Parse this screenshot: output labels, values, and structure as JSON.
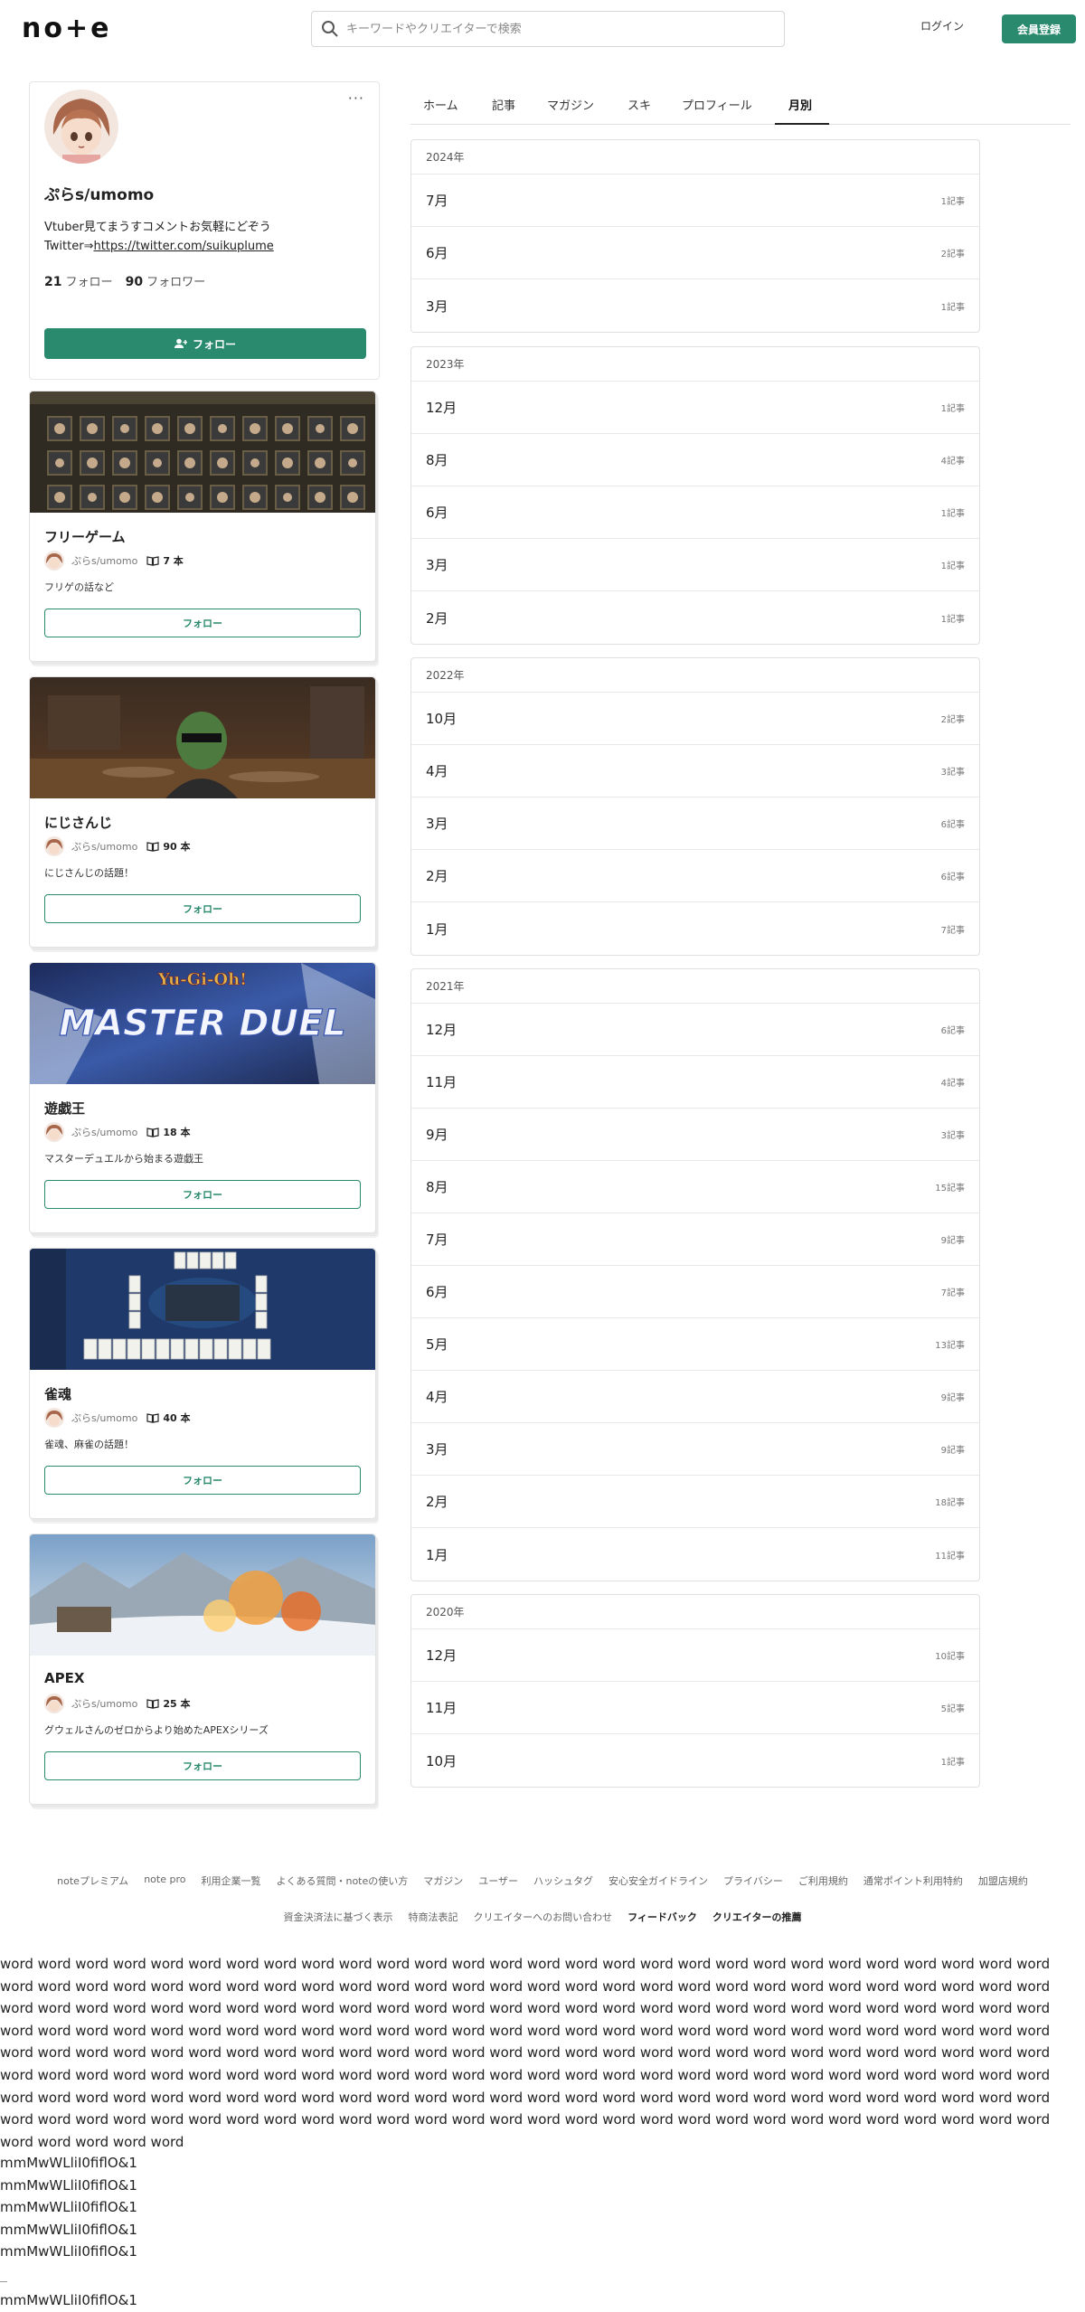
{
  "header": {
    "logo": "no+e",
    "search_placeholder": "キーワードやクリエイターで検索",
    "login": "ログイン",
    "signup": "会員登録"
  },
  "profile": {
    "name": "ぷらs/umomo",
    "bio_line1": "Vtuber見てまうすコメントお気軽にどぞう",
    "bio_line2_prefix": "Twitter⇒",
    "bio_link": "https://twitter.com/suikuplume",
    "following_count": "21",
    "following_label": "フォロー",
    "followers_count": "90",
    "followers_label": "フォロワー",
    "follow_button": "フォロー",
    "more": "···"
  },
  "magazines": [
    {
      "title": "フリーゲーム",
      "author": "ぷらs/umomo",
      "count": "7 本",
      "desc": "フリゲの話など",
      "follow": "フォロー"
    },
    {
      "title": "にじさんじ",
      "author": "ぷらs/umomo",
      "count": "90 本",
      "desc": "にじさんじの話題！",
      "follow": "フォロー"
    },
    {
      "title": "遊戯王",
      "author": "ぷらs/umomo",
      "count": "18 本",
      "desc": "マスターデュエルから始まる遊戯王",
      "follow": "フォロー",
      "thumb_text_top": "Yu-Gi-Oh!",
      "thumb_text_main": "MASTER DUEL"
    },
    {
      "title": "雀魂",
      "author": "ぷらs/umomo",
      "count": "40 本",
      "desc": "雀魂、麻雀の話題！",
      "follow": "フォロー"
    },
    {
      "title": "APEX",
      "author": "ぷらs/umomo",
      "count": "25 本",
      "desc": "グウェルさんのゼロからより始めたAPEXシリーズ",
      "follow": "フォロー"
    }
  ],
  "tabs": [
    "ホーム",
    "記事",
    "マガジン",
    "スキ",
    "プロフィール",
    "月別"
  ],
  "archive": [
    {
      "year": "2024年",
      "months": [
        {
          "m": "7月",
          "c": "1記事"
        },
        {
          "m": "6月",
          "c": "2記事"
        },
        {
          "m": "3月",
          "c": "1記事"
        }
      ]
    },
    {
      "year": "2023年",
      "months": [
        {
          "m": "12月",
          "c": "1記事"
        },
        {
          "m": "8月",
          "c": "4記事"
        },
        {
          "m": "6月",
          "c": "1記事"
        },
        {
          "m": "3月",
          "c": "1記事"
        },
        {
          "m": "2月",
          "c": "1記事"
        }
      ]
    },
    {
      "year": "2022年",
      "months": [
        {
          "m": "10月",
          "c": "2記事"
        },
        {
          "m": "4月",
          "c": "3記事"
        },
        {
          "m": "3月",
          "c": "6記事"
        },
        {
          "m": "2月",
          "c": "6記事"
        },
        {
          "m": "1月",
          "c": "7記事"
        }
      ]
    },
    {
      "year": "2021年",
      "months": [
        {
          "m": "12月",
          "c": "6記事"
        },
        {
          "m": "11月",
          "c": "4記事"
        },
        {
          "m": "9月",
          "c": "3記事"
        },
        {
          "m": "8月",
          "c": "15記事"
        },
        {
          "m": "7月",
          "c": "9記事"
        },
        {
          "m": "6月",
          "c": "7記事"
        },
        {
          "m": "5月",
          "c": "13記事"
        },
        {
          "m": "4月",
          "c": "9記事"
        },
        {
          "m": "3月",
          "c": "9記事"
        },
        {
          "m": "2月",
          "c": "18記事"
        },
        {
          "m": "1月",
          "c": "11記事"
        }
      ]
    },
    {
      "year": "2020年",
      "months": [
        {
          "m": "12月",
          "c": "10記事"
        },
        {
          "m": "11月",
          "c": "5記事"
        },
        {
          "m": "10月",
          "c": "1記事"
        }
      ]
    }
  ],
  "footer_links_1": [
    "noteプレミアム",
    "note pro",
    "利用企業一覧",
    "よくある質問・noteの使い方",
    "マガジン",
    "ユーザー",
    "ハッシュタグ",
    "安心安全ガイドライン",
    "プライバシー",
    "ご利用規約",
    "通常ポイント利用特約",
    "加盟店規約"
  ],
  "footer_links_2": [
    "資金決済法に基づく表示",
    "特商法表記",
    "クリエイターへのお問い合わせ",
    "フィードバック",
    "クリエイターの推薦"
  ],
  "filler_text": "word word word word word word word word word word word word word word word word word word word word word word word word word word word word word word word word word word word word word word word word word word word word word word word word word word word word word word word word word word word word word word word word word word word word word word word word word word word word word word word word word word word word word word word word word word word word word word word word word word word word word word word word word word word word word word word word word word word word word word word word word word word word word word word word word word word word word word word word word word word word word word word word word word word word word word word word word word word word word word word word word word word word word word word word word word word word word word word word word word word word word word word word word word word word word word word word word word word word word word word word word word word word word word word word word word word word word word word word word word word word word word word word word word word word word",
  "glyph_samples": [
    "mmMwWLliI0fiflO&1",
    "mmMwWLliI0fiflO&1",
    "mmMwWLliI0fiflO&1",
    "mmMwWLliI0fiflO&1",
    "mmMwWLliI0fiflO&1",
    "mmMwWLliI0fiflO&1"
  ],
  "colors": {
    "accent": "#2a8a6d"
  }
}
